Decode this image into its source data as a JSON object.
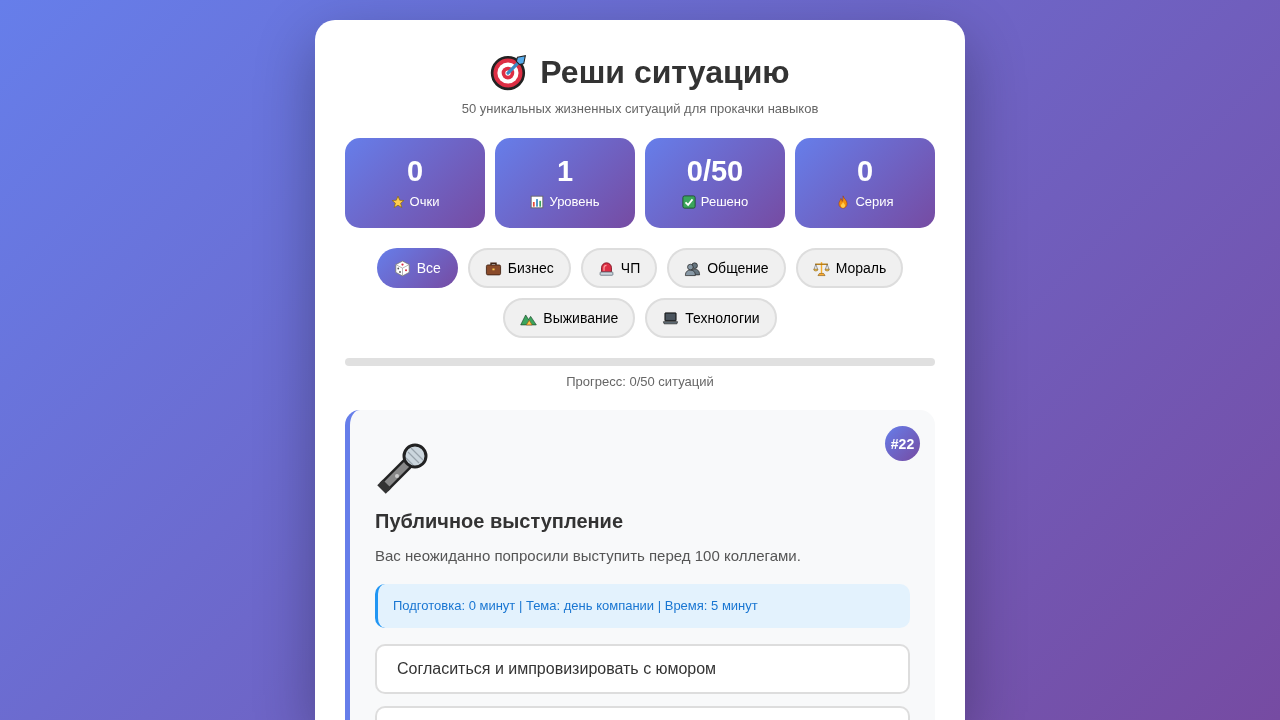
{
  "header": {
    "title": "Реши ситуацию",
    "subtitle": "50 уникальных жизненных ситуаций для прокачки навыков"
  },
  "stats": [
    {
      "value": "0",
      "label": "Очки"
    },
    {
      "value": "1",
      "label": "Уровень"
    },
    {
      "value": "0/50",
      "label": "Решено"
    },
    {
      "value": "0",
      "label": "Серия"
    }
  ],
  "filters": [
    {
      "label": "Все",
      "selected": true
    },
    {
      "label": "Бизнес",
      "selected": false
    },
    {
      "label": "ЧП",
      "selected": false
    },
    {
      "label": "Общение",
      "selected": false
    },
    {
      "label": "Мораль",
      "selected": false
    },
    {
      "label": "Выживание",
      "selected": false
    },
    {
      "label": "Технологии",
      "selected": false
    }
  ],
  "progress": {
    "level": 0,
    "caption": "Прогресс: 0/50 ситуаций"
  },
  "situation": {
    "number": "#22",
    "title": "Публичное выступление",
    "description": "Вас неожиданно попросили выступить перед 100 коллегами.",
    "details": "Подготовка: 0 минут | Тема: день компании | Время: 5 минут",
    "options": [
      {
        "kind": "answer",
        "label": "Согласиться и импровизировать с юмором"
      },
      {
        "kind": "cut-off"
      }
    ]
  }
}
